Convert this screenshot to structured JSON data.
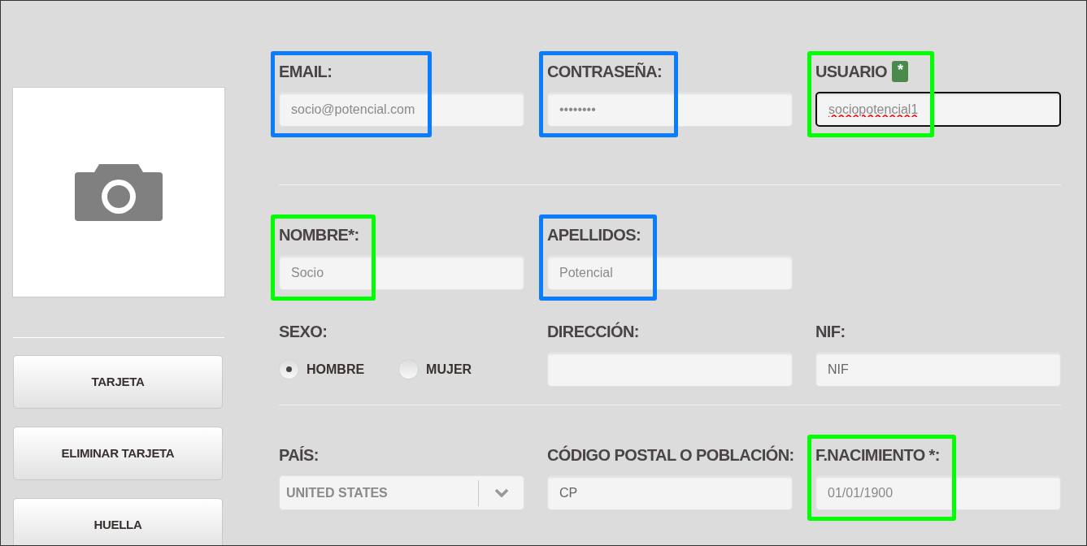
{
  "side_buttons": [
    {
      "label": "TARJETA"
    },
    {
      "label": "ELIMINAR TARJETA"
    },
    {
      "label": "HUELLA"
    }
  ],
  "rows": [
    {
      "divider_before": false,
      "fields": [
        {
          "kind": "text",
          "label": "EMAIL:",
          "value": "socio@potencial.com",
          "color": "#0a7cff"
        },
        {
          "kind": "text",
          "label": "CONTRASEÑA:",
          "value": "••••••••",
          "color": "#0a7cff"
        },
        {
          "kind": "text",
          "label": "USUARIO",
          "badge": "*",
          "value": "sociopotencial1",
          "focused": true,
          "spell_error": true,
          "color": "#00ff00"
        }
      ]
    },
    {
      "divider_before": true,
      "fields": [
        {
          "kind": "text",
          "label": "NOMBRE*:",
          "value": "Socio",
          "color": "#00ff00"
        },
        {
          "kind": "text",
          "label": "APELLIDOS:",
          "value": "Potencial",
          "color": "#0a7cff"
        }
      ]
    },
    {
      "divider_before": false,
      "fields": [
        {
          "kind": "radio",
          "label": "SEXO:",
          "options": [
            {
              "label": "HOMBRE",
              "selected": true
            },
            {
              "label": "MUJER",
              "selected": false
            }
          ]
        },
        {
          "kind": "text",
          "label": "DIRECCIÓN:"
        },
        {
          "kind": "text",
          "label": "NIF:",
          "placeholder": "NIF"
        }
      ]
    },
    {
      "divider_before": true,
      "fields": [
        {
          "kind": "select",
          "label": "PAÍS:",
          "value": "UNITED STATES"
        },
        {
          "kind": "text",
          "label": "CÓDIGO POSTAL O POBLACIÓN:",
          "placeholder": "CP"
        },
        {
          "kind": "text",
          "label": "F.NACIMIENTO *:",
          "value": "01/01/1900",
          "color": "#00ff00"
        }
      ]
    }
  ]
}
